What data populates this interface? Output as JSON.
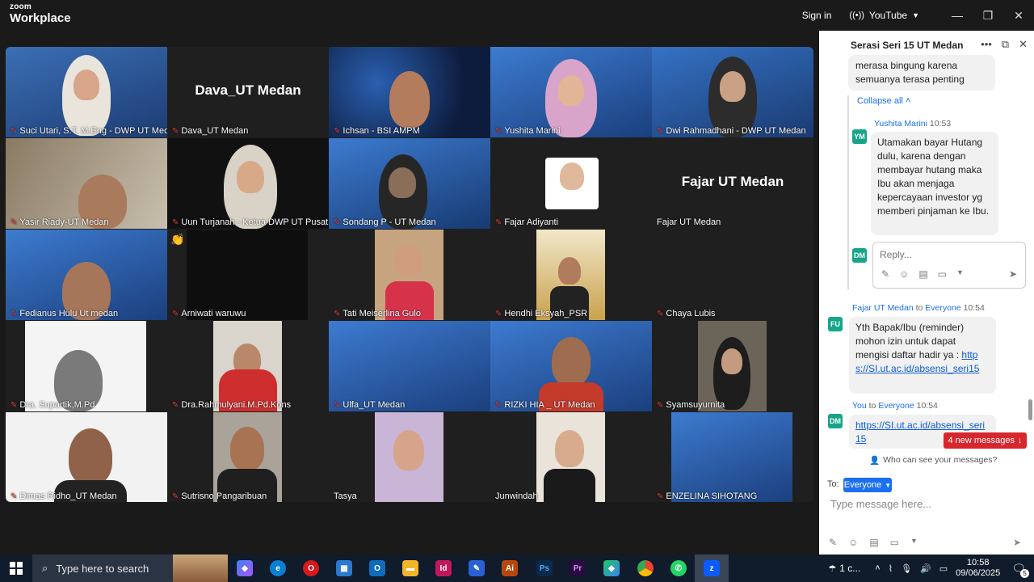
{
  "app": {
    "brand_small": "zoom",
    "brand": "Workplace"
  },
  "titlebar": {
    "signin": "Sign in",
    "stream": "YouTube"
  },
  "tiles": [
    {
      "name": "Suci Utari, S.T, M.Eng - DWP UT Medan",
      "big": ""
    },
    {
      "name": "Dava_UT Medan",
      "big": "Dava_UT Medan"
    },
    {
      "name": "Ichsan - BSI AMPM",
      "big": ""
    },
    {
      "name": "Yushita Marini",
      "big": ""
    },
    {
      "name": "Dwi Rahmadhani - DWP UT Medan",
      "big": ""
    },
    {
      "name": "Yasir Riady-UT Medan",
      "big": ""
    },
    {
      "name": "Uun Turjanah - Ketua DWP UT Pusat",
      "big": ""
    },
    {
      "name": "Sondang P - UT Medan",
      "big": ""
    },
    {
      "name": "Fajar Adiyanti",
      "big": ""
    },
    {
      "name": "Fajar UT Medan",
      "big": "Fajar UT Medan"
    },
    {
      "name": "Fedianus Hulu Ut medan",
      "big": ""
    },
    {
      "name": "Arniwati waruwu",
      "big": ""
    },
    {
      "name": "Tati Meiserlina Gulo",
      "big": ""
    },
    {
      "name": "Hendhi Eksyah_PSR",
      "big": ""
    },
    {
      "name": "Chaya Lubis",
      "big": ""
    },
    {
      "name": "Dra. Supartik,M.Pd",
      "big": ""
    },
    {
      "name": "Dra.Rahmulyani.M.Pd.Kons",
      "big": ""
    },
    {
      "name": "Ulfa_UT Medan",
      "big": ""
    },
    {
      "name": "RIZKI HIA _ UT Medan",
      "big": ""
    },
    {
      "name": "Syamsuyurnita",
      "big": ""
    },
    {
      "name": "Dimas Ridho_UT Medan",
      "big": ""
    },
    {
      "name": "Sutrisno Pangaribuan",
      "big": ""
    },
    {
      "name": "Tasya",
      "big": ""
    },
    {
      "name": "Junwindah",
      "big": ""
    },
    {
      "name": "ENZELINA SIHOTANG",
      "big": ""
    }
  ],
  "chat": {
    "title": "Serasi Seri 15 UT Medan",
    "msg_top": "merasa bingung karena semuanya terasa penting",
    "collapse": "Collapse all",
    "yushita": {
      "initials": "YM",
      "name": "Yushita Marini",
      "time": "10:53",
      "text": "Utamakan bayar Hutang dulu, karena dengan membayar hutang maka Ibu akan menjaga kepercayaan investor yg memberi pinjaman ke Ibu."
    },
    "reply_initials": "DM",
    "reply_placeholder": "Reply...",
    "fajar": {
      "initials": "FU",
      "name": "Fajar UT Medan",
      "to": "to",
      "audience": "Everyone",
      "time": "10:54",
      "text": "Yth Bapak/Ibu (reminder) mohon izin untuk dapat mengisi daftar hadir ya :",
      "link": "https://SI.ut.ac.id/absensi_seri15"
    },
    "you": {
      "initials": "DM",
      "name": "You",
      "to": "to",
      "audience": "Everyone",
      "time": "10:54",
      "link": "https://SI.ut.ac.id/absensi_seri15"
    },
    "new_messages": "4 new messages",
    "who_can_see": "Who can see your messages?",
    "to_label": "To:",
    "to_value": "Everyone",
    "input_placeholder": "Type message here..."
  },
  "taskbar": {
    "search_placeholder": "Type here to search",
    "weather": "1 c...",
    "time": "10:58",
    "date": "09/06/2025",
    "notif_count": "5"
  }
}
